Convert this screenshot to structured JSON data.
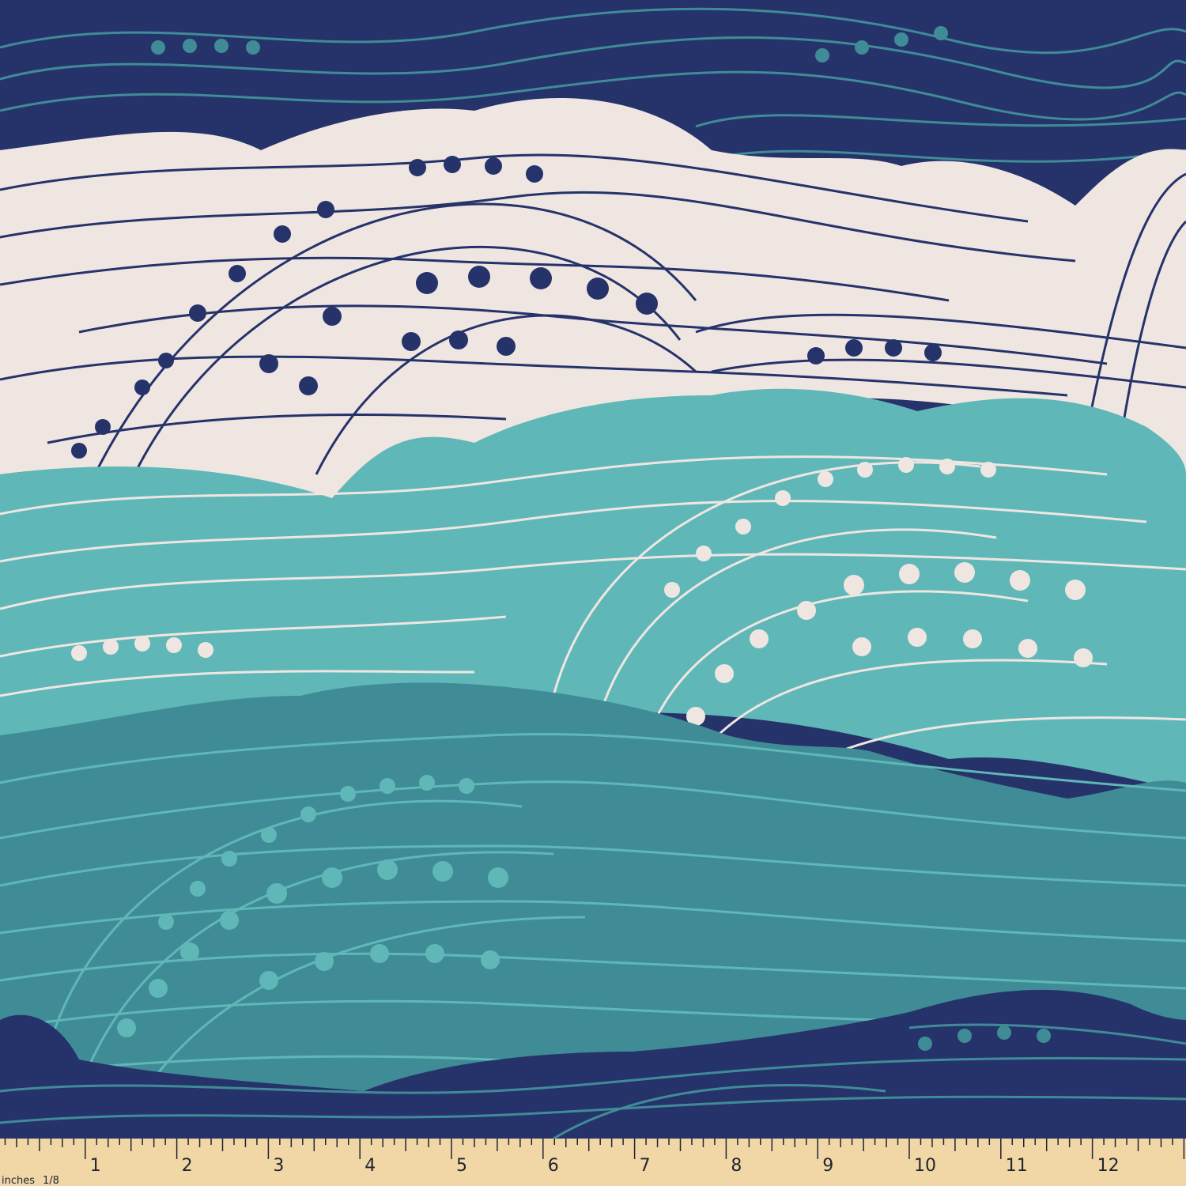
{
  "colors": {
    "navy": "#26336a",
    "navy_dots": "#3f8c97",
    "cream": "#efe6e2",
    "cream_dots": "#26336a",
    "teal": "#5fb8b7",
    "teal_dots": "#efe6e2",
    "deep_teal": "#3f8c97",
    "deep_teal_dots": "#5fb8b7",
    "ruler": "#f2d7a6"
  },
  "ruler": {
    "unit_label": "inches",
    "fraction_label": "1/8",
    "numbers": [
      "1",
      "2",
      "3",
      "4",
      "5",
      "6",
      "7",
      "8",
      "9",
      "10",
      "11",
      "12",
      "1"
    ]
  }
}
